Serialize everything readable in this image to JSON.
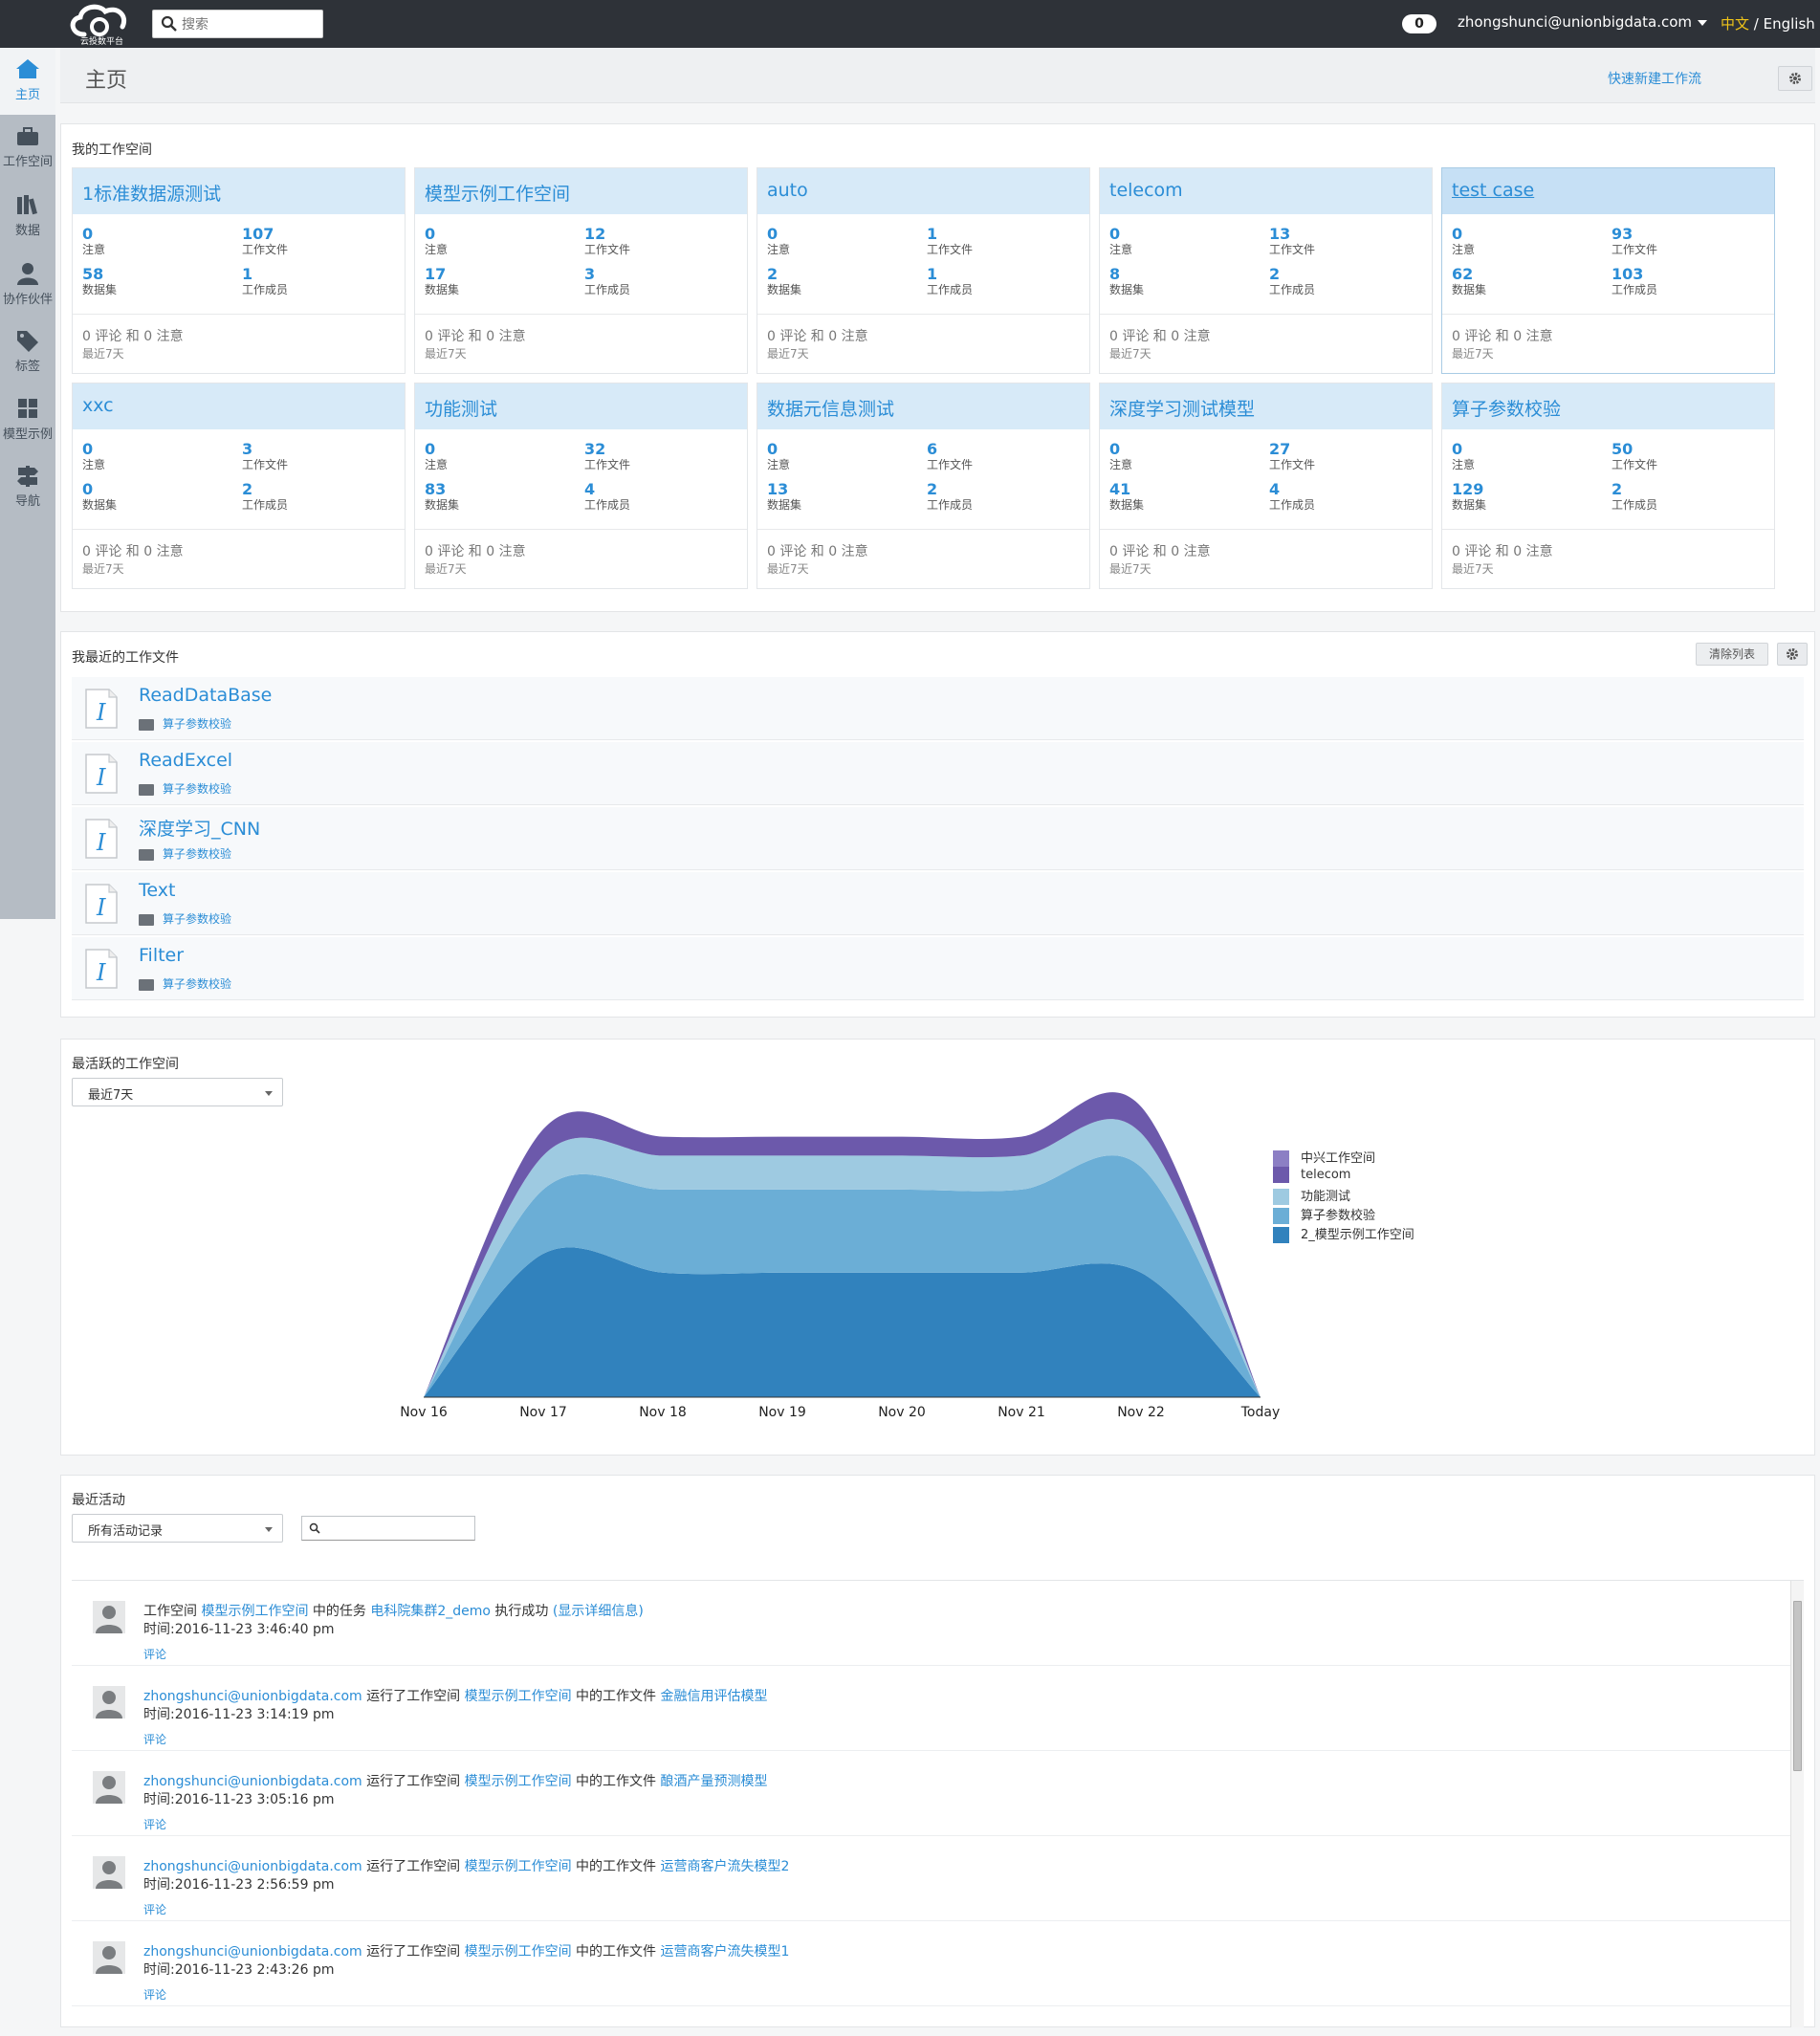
{
  "topbar": {
    "logo_text": "云投数平台",
    "search_placeholder": "搜索",
    "notification_count": "0",
    "user_email": "zhongshunci@unionbigdata.com",
    "lang_zh": "中文",
    "lang_sep": " / ",
    "lang_en": "English"
  },
  "sidebar": {
    "items": [
      {
        "label": "主页",
        "icon": "home-icon"
      },
      {
        "label": "工作空间",
        "icon": "briefcase-icon"
      },
      {
        "label": "数据",
        "icon": "books-icon"
      },
      {
        "label": "协作伙伴",
        "icon": "person-icon"
      },
      {
        "label": "标签",
        "icon": "tag-icon"
      },
      {
        "label": "模型示例",
        "icon": "grid-icon"
      },
      {
        "label": "导航",
        "icon": "signpost-icon"
      }
    ]
  },
  "header": {
    "title": "主页",
    "quick_new": "快速新建工作流"
  },
  "workspaces": {
    "title": "我的工作空间",
    "cards": [
      {
        "name": "1标准数据源测试",
        "s1": "0",
        "l1": "注意",
        "s2": "107",
        "l2": "工作文件",
        "s3": "58",
        "l3": "数据集",
        "s4": "1",
        "l4": "工作成员",
        "comments": "0 评论 和 0 注意",
        "period": "最近7天"
      },
      {
        "name": "模型示例工作空间",
        "s1": "0",
        "l1": "注意",
        "s2": "12",
        "l2": "工作文件",
        "s3": "17",
        "l3": "数据集",
        "s4": "3",
        "l4": "工作成员",
        "comments": "0 评论 和 0 注意",
        "period": "最近7天"
      },
      {
        "name": "auto",
        "s1": "0",
        "l1": "注意",
        "s2": "1",
        "l2": "工作文件",
        "s3": "2",
        "l3": "数据集",
        "s4": "1",
        "l4": "工作成员",
        "comments": "0 评论 和 0 注意",
        "period": "最近7天"
      },
      {
        "name": "telecom",
        "s1": "0",
        "l1": "注意",
        "s2": "13",
        "l2": "工作文件",
        "s3": "8",
        "l3": "数据集",
        "s4": "2",
        "l4": "工作成员",
        "comments": "0 评论 和 0 注意",
        "period": "最近7天"
      },
      {
        "name": "test case",
        "s1": "0",
        "l1": "注意",
        "s2": "93",
        "l2": "工作文件",
        "s3": "62",
        "l3": "数据集",
        "s4": "103",
        "l4": "工作成员",
        "comments": "0 评论 和 0 注意",
        "period": "最近7天"
      },
      {
        "name": "xxc",
        "s1": "0",
        "l1": "注意",
        "s2": "3",
        "l2": "工作文件",
        "s3": "0",
        "l3": "数据集",
        "s4": "2",
        "l4": "工作成员",
        "comments": "0 评论 和 0 注意",
        "period": "最近7天"
      },
      {
        "name": "功能测试",
        "s1": "0",
        "l1": "注意",
        "s2": "32",
        "l2": "工作文件",
        "s3": "83",
        "l3": "数据集",
        "s4": "4",
        "l4": "工作成员",
        "comments": "0 评论 和 0 注意",
        "period": "最近7天"
      },
      {
        "name": "数据元信息测试",
        "s1": "0",
        "l1": "注意",
        "s2": "6",
        "l2": "工作文件",
        "s3": "13",
        "l3": "数据集",
        "s4": "2",
        "l4": "工作成员",
        "comments": "0 评论 和 0 注意",
        "period": "最近7天"
      },
      {
        "name": "深度学习测试模型",
        "s1": "0",
        "l1": "注意",
        "s2": "27",
        "l2": "工作文件",
        "s3": "41",
        "l3": "数据集",
        "s4": "4",
        "l4": "工作成员",
        "comments": "0 评论 和 0 注意",
        "period": "最近7天"
      },
      {
        "name": "算子参数校验",
        "s1": "0",
        "l1": "注意",
        "s2": "50",
        "l2": "工作文件",
        "s3": "129",
        "l3": "数据集",
        "s4": "2",
        "l4": "工作成员",
        "comments": "0 评论 和 0 注意",
        "period": "最近7天"
      }
    ]
  },
  "files": {
    "title": "我最近的工作文件",
    "clear_label": "清除列表",
    "items": [
      {
        "name": "ReadDataBase",
        "workspace": "算子参数校验"
      },
      {
        "name": "ReadExcel",
        "workspace": "算子参数校验"
      },
      {
        "name": "深度学习_CNN",
        "workspace": "算子参数校验"
      },
      {
        "name": "Text",
        "workspace": "算子参数校验"
      },
      {
        "name": "Filter",
        "workspace": "算子参数校验"
      }
    ]
  },
  "active": {
    "title": "最活跃的工作空间",
    "period_selected": "最近7天"
  },
  "chart_data": {
    "type": "area",
    "stacked": true,
    "categories": [
      "Nov 16",
      "Nov 17",
      "Nov 18",
      "Nov 19",
      "Nov 20",
      "Nov 21",
      "Nov 22",
      "Today"
    ],
    "series": [
      {
        "name": "2_模型示例工作空间",
        "color": "#3182bd",
        "values": [
          0,
          38,
          33,
          33,
          33,
          33,
          33,
          0
        ]
      },
      {
        "name": "算子参数校验",
        "color": "#6baed6",
        "values": [
          0,
          17,
          22,
          22,
          22,
          22,
          28,
          0
        ]
      },
      {
        "name": "功能测试",
        "color": "#9ecae1",
        "values": [
          0,
          9,
          9,
          9,
          9,
          9,
          9,
          0
        ]
      },
      {
        "name": "telecom",
        "color": "#6c59ab",
        "values": [
          0,
          7,
          5,
          5,
          5,
          5,
          7,
          0
        ]
      },
      {
        "name": "中兴工作空间",
        "color": "#8c7fc4",
        "values": [
          0,
          0,
          0,
          0,
          0,
          0,
          0,
          0
        ]
      }
    ],
    "legend_position": "right"
  },
  "activity": {
    "title": "最近活动",
    "filter_selected": "所有活动记录",
    "items": [
      {
        "p1": "工作空间 ",
        "link1": "模型示例工作空间",
        "p2": " 中的任务 ",
        "link2": "电科院集群2_demo",
        "p3": " 执行成功 ",
        "link3": "(显示详细信息)",
        "time": "时间:2016-11-23 3:46:40 pm",
        "comment": "评论"
      },
      {
        "p1": "",
        "link1": "zhongshunci@unionbigdata.com",
        "p2": " 运行了工作空间 ",
        "link2": "模型示例工作空间",
        "p3": " 中的工作文件 ",
        "link3": "金融信用评估模型",
        "time": "时间:2016-11-23 3:14:19 pm",
        "comment": "评论"
      },
      {
        "p1": "",
        "link1": "zhongshunci@unionbigdata.com",
        "p2": " 运行了工作空间 ",
        "link2": "模型示例工作空间",
        "p3": " 中的工作文件 ",
        "link3": "酿酒产量预测模型",
        "time": "时间:2016-11-23 3:05:16 pm",
        "comment": "评论"
      },
      {
        "p1": "",
        "link1": "zhongshunci@unionbigdata.com",
        "p2": " 运行了工作空间 ",
        "link2": "模型示例工作空间",
        "p3": " 中的工作文件 ",
        "link3": "运营商客户流失模型2",
        "time": "时间:2016-11-23 2:56:59 pm",
        "comment": "评论"
      },
      {
        "p1": "",
        "link1": "zhongshunci@unionbigdata.com",
        "p2": " 运行了工作空间 ",
        "link2": "模型示例工作空间",
        "p3": " 中的工作文件 ",
        "link3": "运营商客户流失模型1",
        "time": "时间:2016-11-23 2:43:26 pm",
        "comment": "评论"
      }
    ]
  }
}
